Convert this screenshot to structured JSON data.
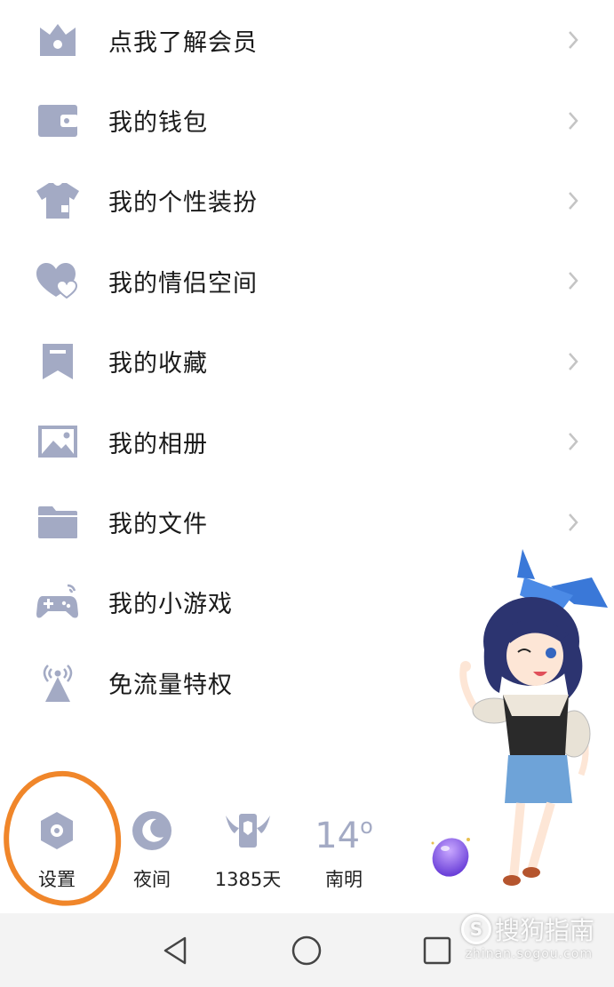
{
  "menu": {
    "items": [
      {
        "label": "点我了解会员",
        "icon": "crown-icon"
      },
      {
        "label": "我的钱包",
        "icon": "wallet-icon"
      },
      {
        "label": "我的个性装扮",
        "icon": "shirt-icon"
      },
      {
        "label": "我的情侣空间",
        "icon": "hearts-icon"
      },
      {
        "label": "我的收藏",
        "icon": "bookmark-icon"
      },
      {
        "label": "我的相册",
        "icon": "photo-icon"
      },
      {
        "label": "我的文件",
        "icon": "folder-icon"
      },
      {
        "label": "我的小游戏",
        "icon": "gamepad-icon"
      },
      {
        "label": "免流量特权",
        "icon": "signal-tower-icon"
      }
    ]
  },
  "bottom_bar": {
    "settings": "设置",
    "night": "夜间",
    "days": "1385天",
    "temperature": "14",
    "degree": "o",
    "weather": "南明"
  },
  "watermark": {
    "logo": "S",
    "text": "搜狗指南",
    "url": "zhinan.sogou.com"
  },
  "colors": {
    "icon": "#a3aac4",
    "chevron": "#c4c4c4",
    "highlight_circle": "#f0862a",
    "navbar": "#f3f3f3"
  }
}
